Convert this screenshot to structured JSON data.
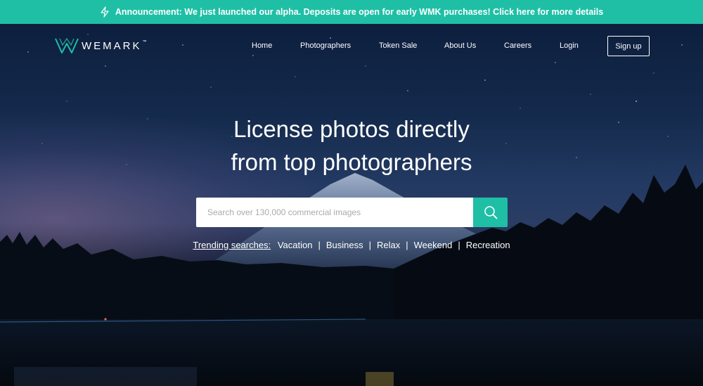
{
  "announcement": {
    "icon": "lightning-icon",
    "text": "Announcement: We just launched our alpha. Deposits are open for early WMK purchases! Click here for more details"
  },
  "brand": {
    "name": "WEMARK",
    "tm": "™",
    "accent": "#1fbfa6"
  },
  "nav": {
    "items": [
      {
        "label": "Home"
      },
      {
        "label": "Photographers"
      },
      {
        "label": "Token Sale"
      },
      {
        "label": "About Us"
      },
      {
        "label": "Careers"
      },
      {
        "label": "Login"
      }
    ],
    "signup_label": "Sign up"
  },
  "hero": {
    "line1": "License photos directly",
    "line2": "from top photographers"
  },
  "search": {
    "placeholder": "Search over 130,000 commercial images",
    "button_icon": "search-icon"
  },
  "trending": {
    "label": "Trending searches:",
    "items": [
      "Vacation",
      "Business",
      "Relax",
      "Weekend",
      "Recreation"
    ]
  }
}
